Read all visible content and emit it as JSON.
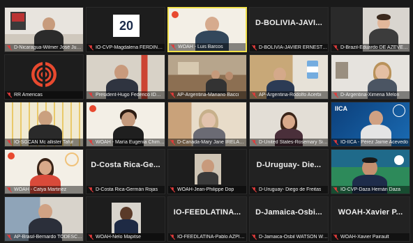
{
  "meeting": {
    "participants": [
      {
        "label": "D-Nicaragua-Wilmer José Juárez Juár..."
      },
      {
        "label": "IO-CVP-Magdalena FERDINAND",
        "logo_text": "20"
      },
      {
        "label": "WOAH - Luis Barcos",
        "active": true
      },
      {
        "label": "D-BOLIVIA-JAVIER ERNESTO SUA...",
        "display_name": "D-BOLIVIA-JAVI..."
      },
      {
        "label": "D-Brazil-Eduardo DE AZEVEDO PED"
      },
      {
        "label": "RR Americas"
      },
      {
        "label": "President-Hugo Federico IDOYAG..."
      },
      {
        "label": "AP-Argentina-Mariano Bacci"
      },
      {
        "label": "AP-Argentina-Rodolfo Acerbi"
      },
      {
        "label": "D-Argentina-Ximena Melon"
      },
      {
        "label": "IO-SGCAN Mc allister Tafur"
      },
      {
        "label": "WOAH - María Eugenia Chimenti"
      },
      {
        "label": "D-Canada-Mary Jane IRELAND Irel..."
      },
      {
        "label": "D-United States-Rosemary Sifford"
      },
      {
        "label": "IO-IICA - Pérez Jaime Acevedo",
        "logo_text": "IICA"
      },
      {
        "label": "WOAH - Catya Martinez"
      },
      {
        "label": "D-Costa Rica-Germán Rojas",
        "display_name": "D-Costa Rica-Ge..."
      },
      {
        "label": "WOAH-Jean-Philippe Dop"
      },
      {
        "label": "D-Uruguay- Diego de Freitas",
        "display_name": "D-Uruguay- Die..."
      },
      {
        "label": "IO-CVP-Daza Hernán Daza"
      },
      {
        "label": "AP-Brasil-Bernardo TODESCHINI"
      },
      {
        "label": "WOAH-Nelo Mapitse"
      },
      {
        "label": "IO-FEEDLATINA-Pablo AZPIROZ",
        "display_name": "IO-FEEDLATINA..."
      },
      {
        "label": "D-Jamaica-Osbil WATSON Watson",
        "display_name": "D-Jamaica-Osbi..."
      },
      {
        "label": "WOAH-Xavier Pairault",
        "display_name": "WOAH-Xavier P..."
      }
    ]
  },
  "colors": {
    "active_border": "#f2e24b",
    "mic_muted": "#e23b3b",
    "tile_bg": "#222222"
  }
}
